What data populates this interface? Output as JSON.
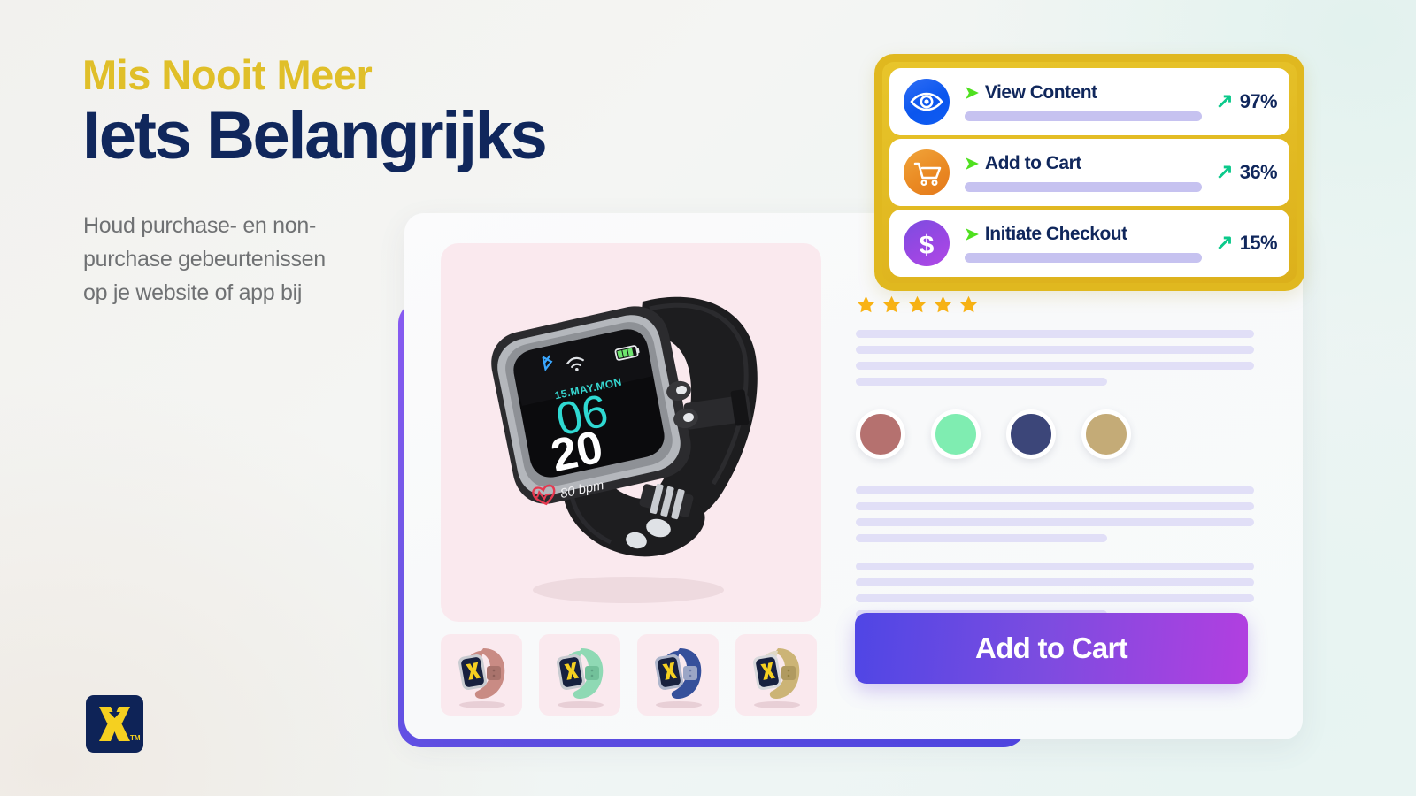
{
  "hero": {
    "eyebrow": "Mis Nooit Meer",
    "headline": "Iets Belangrijks",
    "subcopy": "Houd purchase- en non-purchase gebeurtenissen op je website of app bij"
  },
  "brand": {
    "logo_letter": "X",
    "trademark": "TM",
    "logo_bg": "#0e2357",
    "logo_fg": "#f5d020"
  },
  "metrics": {
    "frame_color": "#e0b81f",
    "items": [
      {
        "icon": "eye-icon",
        "chevron": "➤",
        "label": "View Content",
        "arrow": "↗",
        "value": "97%",
        "icon_color": "#0b56ee"
      },
      {
        "icon": "cart-icon",
        "chevron": "➤",
        "label": "Add to Cart",
        "arrow": "↗",
        "value": "36%",
        "icon_color": "#ea8a23"
      },
      {
        "icon": "dollar-icon",
        "chevron": "➤",
        "label": "Initiate Checkout",
        "arrow": "↗",
        "value": "15%",
        "icon_color": "#9a47e3"
      }
    ]
  },
  "product": {
    "rating_stars": 5,
    "star_color": "#f9b315",
    "watch_face": {
      "date": "15.MAY.MON",
      "hour": "06",
      "minute": "20",
      "bpm": "80 bpm"
    },
    "swatches": [
      {
        "name": "rose",
        "color": "#b5716f"
      },
      {
        "name": "mint",
        "color": "#7fedb1"
      },
      {
        "name": "navy",
        "color": "#3c4679"
      },
      {
        "name": "tan",
        "color": "#c4ab77"
      }
    ],
    "thumbnails": [
      {
        "name": "watch-thumb-rose",
        "band": "#c98b84"
      },
      {
        "name": "watch-thumb-mint",
        "band": "#8fd9b4"
      },
      {
        "name": "watch-thumb-navy",
        "band": "#36509b"
      },
      {
        "name": "watch-thumb-tan",
        "band": "#ccb476"
      }
    ],
    "cta_label": "Add to Cart"
  }
}
